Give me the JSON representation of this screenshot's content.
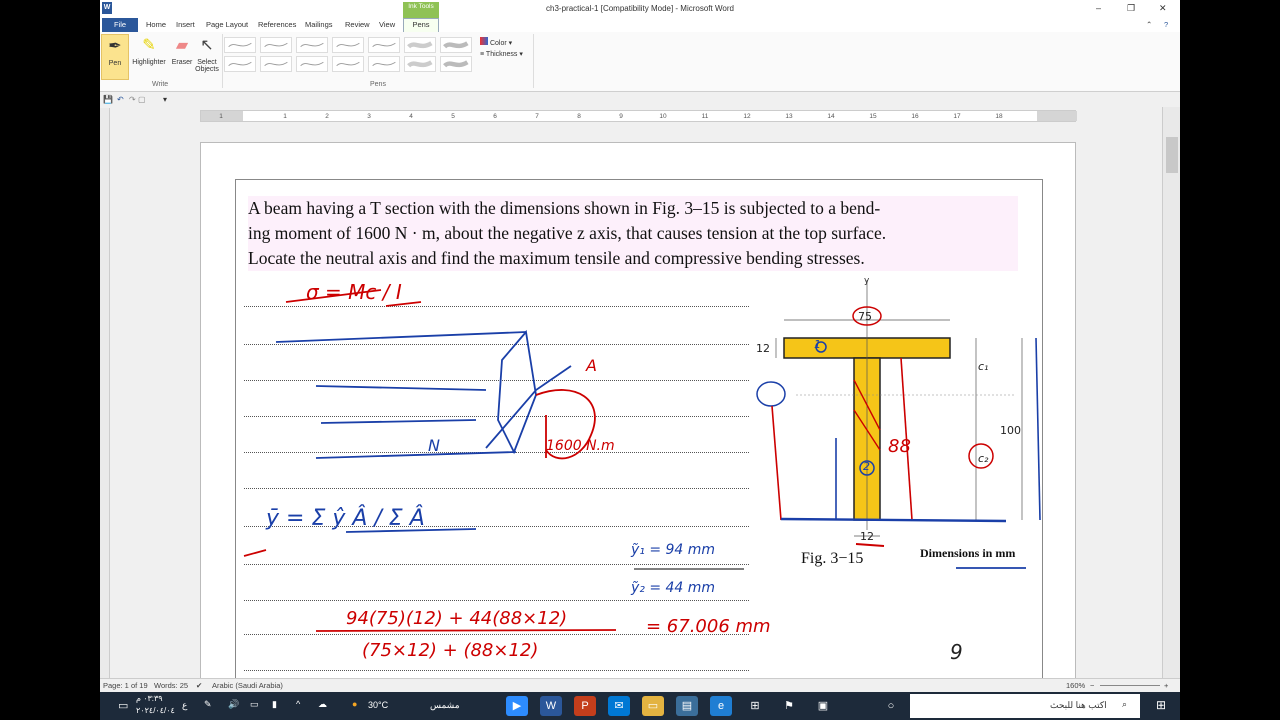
{
  "window": {
    "title": "ch3-practical-1 [Compatibility Mode]  -  Microsoft Word",
    "app_icon": "W",
    "controls": [
      "–",
      "❐",
      "✕"
    ]
  },
  "tabs": [
    "File",
    "Home",
    "Insert",
    "Page Layout",
    "References",
    "Mailings",
    "Review",
    "View"
  ],
  "contextual": {
    "group": "Ink Tools",
    "tab": "Pens"
  },
  "ribbon": {
    "write_buttons": [
      "Pen",
      "Highlighter",
      "Eraser",
      "Select Objects"
    ],
    "write_group_label": "Write",
    "pens_group_label": "Pens",
    "color_label": "Color",
    "thickness_label": "Thickness",
    "accent": "#2b579a",
    "pen_active_color": "#fbe38e"
  },
  "ruler_numbers": [
    "1",
    "1",
    "2",
    "3",
    "4",
    "5",
    "6",
    "7",
    "8",
    "9",
    "10",
    "11",
    "12",
    "13",
    "14",
    "15",
    "16",
    "17",
    "18"
  ],
  "document": {
    "problem_lines": [
      "A beam having a T section with the dimensions shown in Fig. 3–15 is subjected to a bend-",
      "ing moment of 1600 N · m, about the negative z axis, that causes tension at the top surface.",
      "Locate the neutral axis and find the maximum tensile and compressive bending stresses."
    ],
    "figure_caption": "Fig. 3−15",
    "dimensions_caption": "Dimensions in mm",
    "figure_labels": {
      "y": "y",
      "flange_width": "75",
      "flange_thickness": "12",
      "web_width": "12",
      "height": "100",
      "c1": "c₁",
      "c2": "c₂"
    },
    "handwriting": {
      "formula_sigma": "σ = Mc / I",
      "moment": "1600 N.m",
      "n_label": "N",
      "a_label": "A",
      "ybar_formula": "ȳ = Σ ŷ Â / Σ Â",
      "y1": "ỹ₁ = 94 mm",
      "y2": "ỹ₂ = 44 mm",
      "ybar_calc_num": "94(75)(12) + 44(88×12)",
      "ybar_calc_den": "(75×12) + (88×12)",
      "ybar_result": "= 67.006 mm",
      "dim_88": "88",
      "part_1": "1",
      "part_2": "2",
      "page_mark": "9"
    }
  },
  "status": {
    "page": "Page: 1 of 19",
    "words": "Words: 25",
    "language": "Arabic (Saudi Arabia)",
    "zoom": "160%"
  },
  "taskbar": {
    "time": "٠٣:٣٩ م",
    "date": "٢٠٢٤/٠٤/٠٤",
    "lang": "ع",
    "weather_temp": "30°C",
    "weather_desc": "مشمس",
    "search_placeholder": "اكتب هنا للبحث"
  }
}
